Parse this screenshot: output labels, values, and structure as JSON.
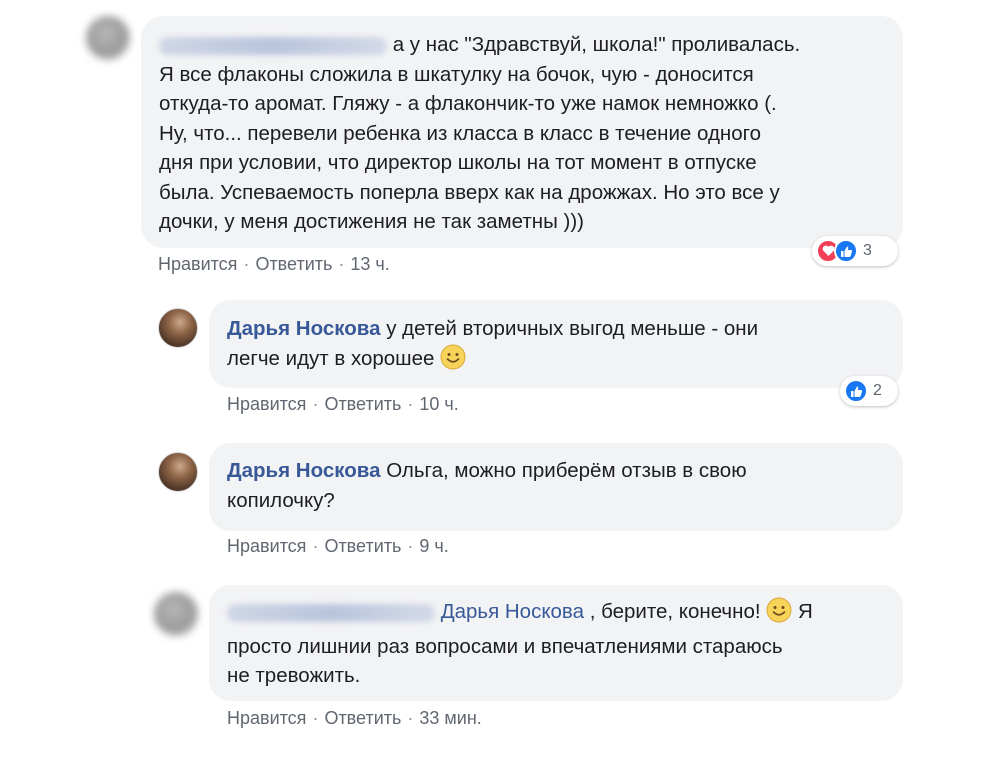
{
  "comments": [
    {
      "author": "",
      "lines": [
        "а у нас \"Здравствуй, школа!\" проливалась.",
        "Я все флаконы сложила в шкатулку на бочок, чую - доносится",
        "откуда-то аромат. Гляжу - а флакончик-то уже намок немножко (.",
        "Ну, что... перевели ребенка из класса в класс в течение одного",
        "дня при условии, что директор школы на тот момент в отпуске",
        "была. Успеваемость поперла вверх как на дрожжах. Но это все у",
        "дочки, у меня достижения не так заметны )))"
      ],
      "like_label": "Нравится",
      "reply_label": "Ответить",
      "time": "13 ч.",
      "reaction_count": "3",
      "reaction_icons": [
        "love-icon",
        "like-icon"
      ]
    },
    {
      "author": "Дарья Носкова",
      "line1": "у детей вторичных выгод меньше - они",
      "line2": "легче идут в хорошее",
      "like_label": "Нравится",
      "reply_label": "Ответить",
      "time": "10 ч.",
      "reaction_count": "2",
      "reaction_icons": [
        "like-icon"
      ]
    },
    {
      "author": "Дарья Носкова",
      "line1": "Ольга, можно приберём отзыв в свою",
      "line2": "копилочку?",
      "like_label": "Нравится",
      "reply_label": "Ответить",
      "time": "9 ч."
    },
    {
      "author": "",
      "mention": "Дарья Носкова",
      "line1_after": ", берите, конечно!",
      "line1_end": "Я",
      "line2": "просто лишнии раз вопросами и впечатлениями стараюсь",
      "line3": "не тревожить.",
      "like_label": "Нравится",
      "reply_label": "Ответить",
      "time": "33 мин."
    }
  ],
  "colors": {
    "bubble": "#f2f3f5",
    "author": "#385898",
    "meta": "#606770",
    "love": "#f33e58",
    "like": "#1877f2"
  }
}
